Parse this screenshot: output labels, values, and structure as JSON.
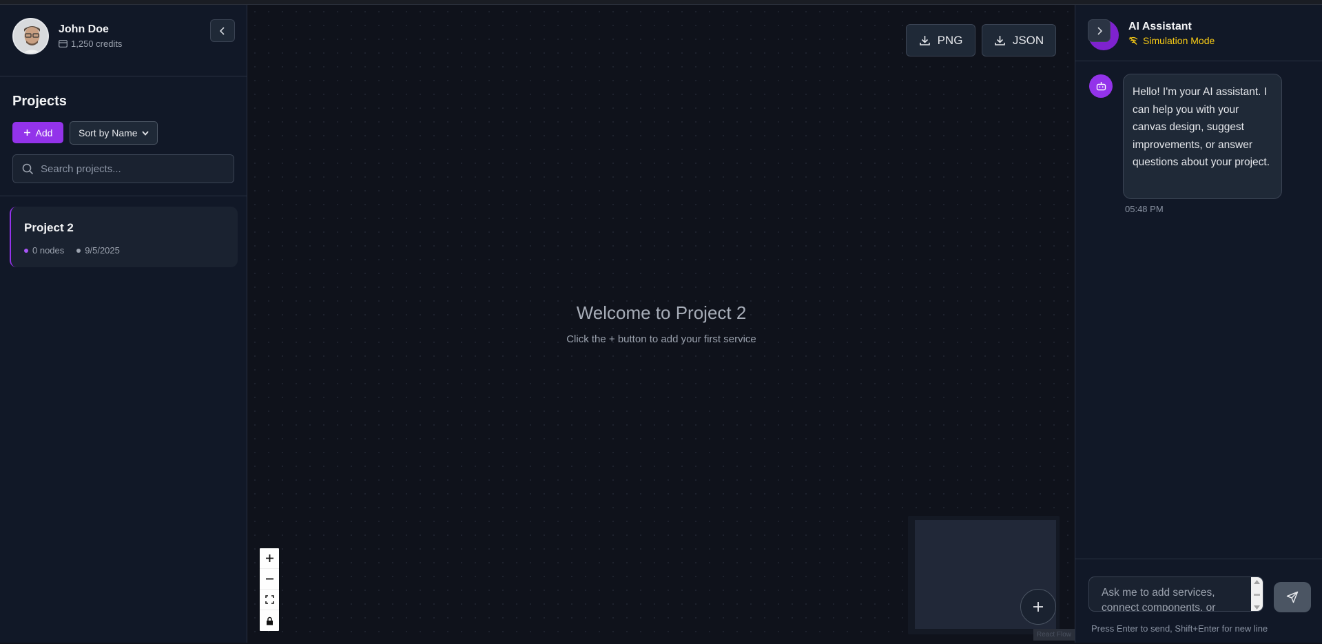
{
  "user": {
    "name": "John Doe",
    "credits": "1,250 credits"
  },
  "sidebar": {
    "heading": "Projects",
    "add_label": "Add",
    "sort_selected": "Sort by Name",
    "search_placeholder": "Search projects...",
    "projects": [
      {
        "title": "Project 2",
        "nodes": "0 nodes",
        "date": "9/5/2025"
      }
    ]
  },
  "canvas": {
    "export_png": "PNG",
    "export_json": "JSON",
    "welcome_title": "Welcome to Project 2",
    "welcome_subtitle": "Click the + button to add your first service",
    "attribution": "React Flow"
  },
  "assistant": {
    "title": "AI Assistant",
    "mode": "Simulation Mode",
    "messages": [
      {
        "text": "Hello! I'm your AI assistant. I can help you with your canvas design, suggest improvements, or answer questions about your project.",
        "time": "05:48 PM"
      }
    ],
    "input_placeholder": "Ask me to add services, connect components, or",
    "hint": "Press Enter to send, Shift+Enter for new line"
  },
  "colors": {
    "accent": "#9333ea",
    "warning": "#facc15",
    "background": "#0f121b",
    "panel": "#111827"
  }
}
